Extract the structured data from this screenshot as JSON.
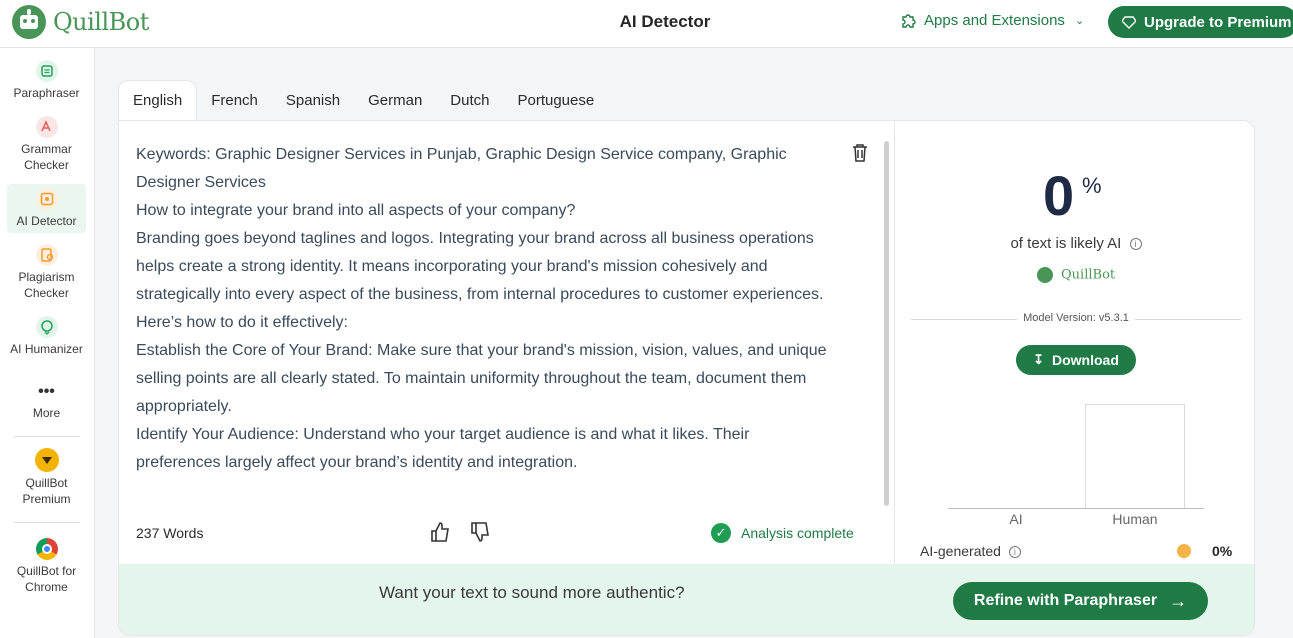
{
  "brand": {
    "name": "QuillBot",
    "color": "#499557"
  },
  "header": {
    "title": "AI Detector",
    "apps_label": "Apps and Extensions",
    "upgrade_label": "Upgrade to Premium"
  },
  "sidebar": {
    "items": [
      {
        "label": "Paraphraser",
        "icon": "paraphraser-icon",
        "color": "#23a45a"
      },
      {
        "label": "Grammar Checker",
        "icon": "grammar-checker-icon",
        "color": "#e35b5b"
      },
      {
        "label": "AI Detector",
        "icon": "ai-detector-icon",
        "color": "#f29a2e"
      },
      {
        "label": "Plagiarism Checker",
        "icon": "plagiarism-checker-icon",
        "color": "#f29a2e"
      },
      {
        "label": "AI Humanizer",
        "icon": "ai-humanizer-icon",
        "color": "#23a45a"
      },
      {
        "label": "More",
        "icon": "more-icon"
      },
      {
        "label": "QuillBot Premium",
        "icon": "premium-diamond-icon",
        "color": "#f3b400"
      },
      {
        "label": "QuillBot for Chrome",
        "icon": "chrome-icon"
      }
    ]
  },
  "tabs": [
    "English",
    "French",
    "Spanish",
    "German",
    "Dutch",
    "Portuguese"
  ],
  "editor": {
    "paragraphs": [
      "Keywords: Graphic Designer Services in Punjab, Graphic Design Service company, Graphic Designer Services",
      "How to integrate your brand into all aspects of your company?",
      "Branding goes beyond taglines and logos. Integrating your brand across all business operations helps create a strong identity. It means incorporating your brand's mission cohesively and strategically into every aspect of the business, from internal procedures to customer experiences.",
      "Here’s how to do it effectively:",
      "Establish the Core of Your Brand: Make sure that your brand's mission, vision, values, and unique selling points are all clearly stated.  To maintain uniformity throughout the team, document them appropriately.",
      "Identify Your Audience: Understand who your target audience is and what it likes. Their preferences largely affect your brand’s identity and integration."
    ],
    "word_count": "237 Words",
    "status": "Analysis complete"
  },
  "result": {
    "percent": "0",
    "percent_sign": "%",
    "likely_label": "of text is likely AI",
    "brand_small": "QuillBot",
    "model_version": "Model Version: v5.3.1",
    "download_label": "Download",
    "ai_generated_label": "AI-generated",
    "ai_generated_value": "0%",
    "ai_color": "#f6b347"
  },
  "chart_data": {
    "type": "bar",
    "categories": [
      "AI",
      "Human"
    ],
    "values": [
      0,
      100
    ],
    "ylim": [
      0,
      100
    ]
  },
  "banner": {
    "text": "Want your text to sound more authentic?",
    "button_label": "Refine with Paraphraser"
  }
}
